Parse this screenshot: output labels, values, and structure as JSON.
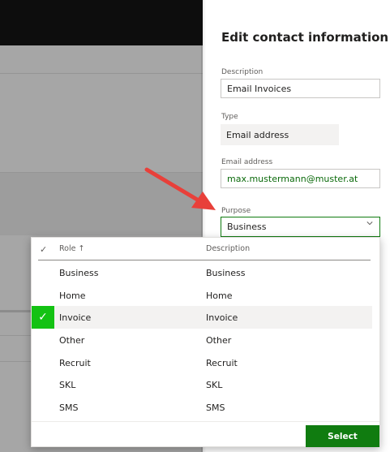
{
  "panel": {
    "title": "Edit contact information",
    "description_label": "Description",
    "description_value": "Email Invoices",
    "type_label": "Type",
    "type_value": "Email address",
    "email_label": "Email address",
    "email_value": "max.mustermann@muster.at",
    "purpose_label": "Purpose",
    "purpose_value": "Business"
  },
  "dropdown": {
    "columns": {
      "role": "Role ↑",
      "description": "Description"
    },
    "rows": [
      {
        "role": "Business",
        "description": "Business",
        "selected": false
      },
      {
        "role": "Home",
        "description": "Home",
        "selected": false
      },
      {
        "role": "Invoice",
        "description": "Invoice",
        "selected": true
      },
      {
        "role": "Other",
        "description": "Other",
        "selected": false
      },
      {
        "role": "Recruit",
        "description": "Recruit",
        "selected": false
      },
      {
        "role": "SKL",
        "description": "SKL",
        "selected": false
      },
      {
        "role": "SMS",
        "description": "SMS",
        "selected": false
      }
    ],
    "select_label": "Select"
  },
  "colors": {
    "accent": "#107c10",
    "check_bg": "#13c213",
    "arrow": "#e8403a"
  }
}
